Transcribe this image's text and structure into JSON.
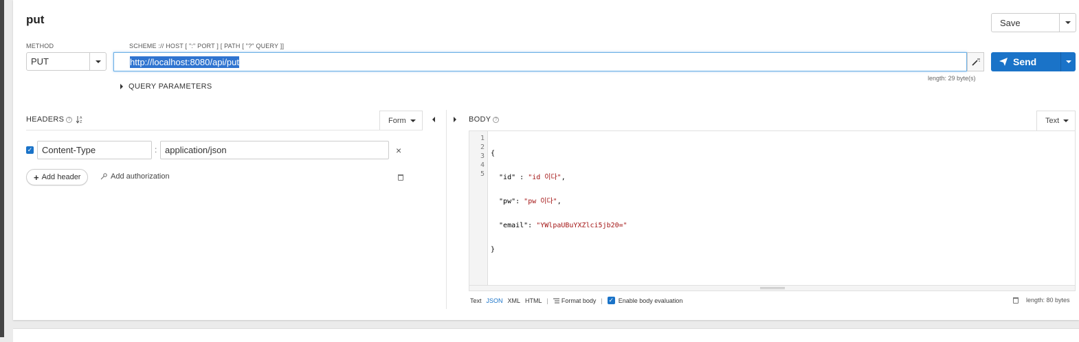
{
  "request": {
    "title": "put",
    "save_label": "Save",
    "method_label": "METHOD",
    "method_value": "PUT",
    "url_hint": "SCHEME :// HOST [ \":\" PORT ] [ PATH [ \"?\" QUERY ]]",
    "url_value": "http://localhost:8080/api/put",
    "send_label": "Send",
    "url_length": "length: 29 byte(s)",
    "query_params_label": "QUERY PARAMETERS"
  },
  "headers": {
    "title": "HEADERS",
    "mode_label": "Form",
    "rows": [
      {
        "enabled": true,
        "name": "Content-Type",
        "value": "application/json"
      }
    ],
    "separator": ":",
    "remove_symbol": "×",
    "add_header_label": "Add header",
    "add_auth_label": "Add authorization"
  },
  "body": {
    "title": "BODY",
    "mode_label": "Text",
    "line_numbers": [
      "1",
      "2",
      "3",
      "4",
      "5"
    ],
    "lines": [
      {
        "pre": "{",
        "str": "",
        "post": ""
      },
      {
        "pre": "  \"id\" : ",
        "str": "\"id 이다\"",
        "post": ","
      },
      {
        "pre": "  \"pw\": ",
        "str": "\"pw 이다\"",
        "post": ","
      },
      {
        "pre": "  \"email\": ",
        "str": "\"YWlpaUBuYXZlci5jb20=\"",
        "post": ""
      },
      {
        "pre": "}",
        "str": "",
        "post": ""
      }
    ],
    "formats": [
      "Text",
      "JSON",
      "XML",
      "HTML"
    ],
    "active_format": "JSON",
    "format_body_label": "Format body",
    "enable_eval_label": "Enable body evaluation",
    "length": "length: 80 bytes"
  }
}
